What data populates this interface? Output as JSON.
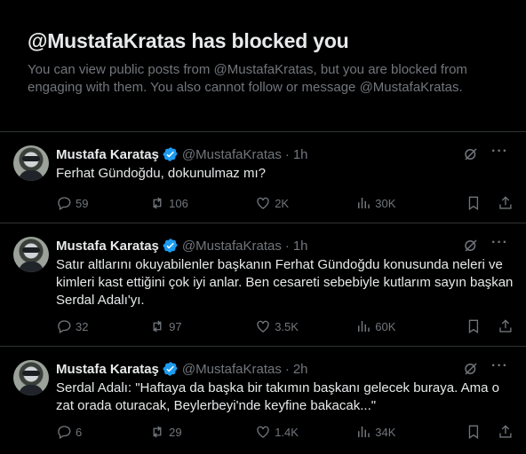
{
  "blocked": {
    "title": "@MustafaKratas has blocked you",
    "message": "You can view public posts from @MustafaKratas, but you are blocked from engaging with them. You also cannot follow or message @MustafaKratas."
  },
  "colors": {
    "accent": "#1d9bf0",
    "muted": "#71767b",
    "text": "#e7e9ea",
    "border": "#2f3336"
  },
  "posts": [
    {
      "author": "Mustafa Karataş",
      "handle": "@MustafaKratas",
      "dot": "·",
      "time": "1h",
      "text": "Ferhat Gündoğdu, dokunulmaz mı?",
      "replies": "59",
      "reposts": "106",
      "likes": "2K",
      "views": "30K"
    },
    {
      "author": "Mustafa Karataş",
      "handle": "@MustafaKratas",
      "dot": "·",
      "time": "1h",
      "text": "Satır altlarını okuyabilenler başkanın Ferhat Gündoğdu konusunda neleri ve kimleri kast ettiğini çok iyi anlar. Ben cesareti sebebiyle kutlarım sayın başkan Serdal Adalı'yı.",
      "replies": "32",
      "reposts": "97",
      "likes": "3.5K",
      "views": "60K"
    },
    {
      "author": "Mustafa Karataş",
      "handle": "@MustafaKratas",
      "dot": "·",
      "time": "2h",
      "text": "Serdal Adalı: \"Haftaya da başka bir takımın başkanı gelecek buraya. Ama o zat orada oturacak, Beylerbeyi'nde keyfine bakacak...\"",
      "replies": "6",
      "reposts": "29",
      "likes": "1.4K",
      "views": "34K"
    }
  ]
}
